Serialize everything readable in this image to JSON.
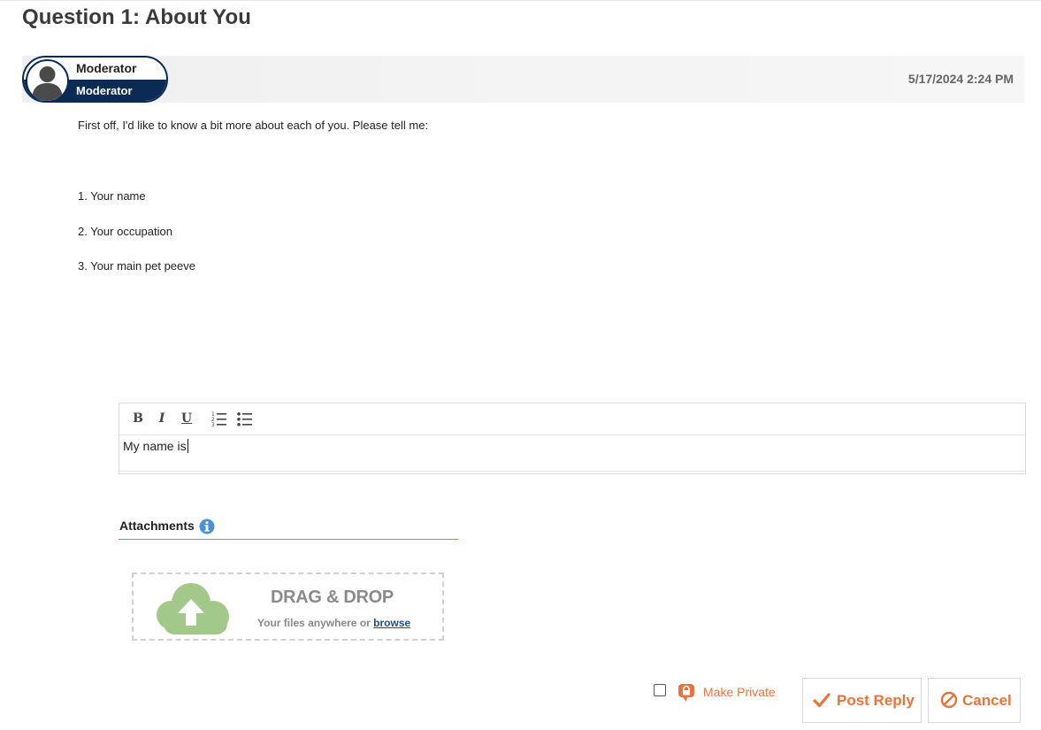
{
  "page": {
    "title": "Question 1: About You"
  },
  "post": {
    "author_name": "Moderator",
    "author_role": "Moderator",
    "date": "5/17/2024 2:24 PM",
    "body": {
      "intro": "First off, I'd like to know a bit more about each of you. Please tell me:",
      "items": [
        "1. Your name",
        "2. Your occupation",
        "3. Your main pet peeve"
      ]
    }
  },
  "editor": {
    "toolbar": {
      "bold": "B",
      "italic": "I",
      "underline": "U"
    },
    "text": "My name is"
  },
  "attachments": {
    "label": "Attachments",
    "drop_title": "DRAG & DROP",
    "drop_sub": "Your files anywhere or",
    "browse": "browse"
  },
  "actions": {
    "make_private": "Make Private",
    "post_reply": "Post Reply",
    "cancel": "Cancel"
  },
  "colors": {
    "accent": "#e8743b",
    "navy": "#0b2a55",
    "cloud_green": "#a3c98a",
    "info_blue": "#4a90d9"
  }
}
